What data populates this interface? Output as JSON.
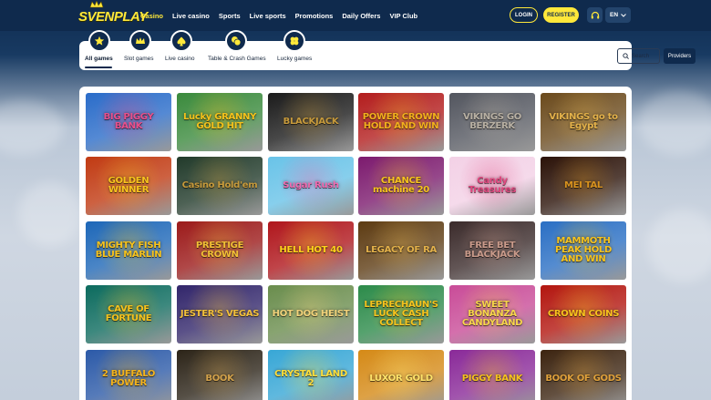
{
  "brand": {
    "logo_text": "SVENPLAY"
  },
  "nav": {
    "items": [
      {
        "label": "Casino",
        "active": true
      },
      {
        "label": "Live casino",
        "active": false
      },
      {
        "label": "Sports",
        "active": false
      },
      {
        "label": "Live sports",
        "active": false
      },
      {
        "label": "Promotions",
        "active": false
      },
      {
        "label": "Daily Offers",
        "active": false
      },
      {
        "label": "VIP Club",
        "active": false
      }
    ]
  },
  "header": {
    "login_label": "LOGIN",
    "register_label": "REGISTER",
    "headset_icon": "headset-icon",
    "language": "EN"
  },
  "categories": {
    "items": [
      {
        "label": "All games",
        "icon": "star-icon",
        "active": true
      },
      {
        "label": "Slot games",
        "icon": "crown-icon",
        "active": false
      },
      {
        "label": "Live casino",
        "icon": "spade-icon",
        "active": false
      },
      {
        "label": "Table & Crash Games",
        "icon": "chips-icon",
        "active": false
      },
      {
        "label": "Lucky games",
        "icon": "clover-icon",
        "active": false
      }
    ],
    "search_placeholder": "Search",
    "providers_label": "Providers"
  },
  "games": {
    "rows": [
      [
        {
          "title": "BIG PIGGY BANK",
          "bg": "#2a6cc9",
          "accent": "#e94f8b"
        },
        {
          "title": "Lucky GRANNY GOLD HIT",
          "bg": "#3a8a3c",
          "accent": "#f5c21b"
        },
        {
          "title": "BLACKJACK",
          "bg": "#1b1b1b",
          "accent": "#c79a3b"
        },
        {
          "title": "POWER CROWN HOLD AND WIN",
          "bg": "#b31d1d",
          "accent": "#f2b01c"
        },
        {
          "title": "VIKINGS GO BERZERK",
          "bg": "#53565f",
          "accent": "#b8b0a3"
        },
        {
          "title": "VIKINGS go to Egypt",
          "bg": "#6b4a1c",
          "accent": "#e3b14a"
        }
      ],
      [
        {
          "title": "GOLDEN WINNER",
          "bg": "#c13a12",
          "accent": "#f7c31d"
        },
        {
          "title": "Casino Hold'em",
          "bg": "#213a2a",
          "accent": "#c79a3b"
        },
        {
          "title": "Sugar Rush",
          "bg": "#69c3e8",
          "accent": "#f06bb0"
        },
        {
          "title": "CHANCE machine 20",
          "bg": "#7c1a6e",
          "accent": "#f7c31d"
        },
        {
          "title": "Candy Treasures",
          "bg": "#f3d1e6",
          "accent": "#e2477f"
        },
        {
          "title": "MEI TAL",
          "bg": "#2b1208",
          "accent": "#d8921e"
        }
      ],
      [
        {
          "title": "MIGHTY FISH BLUE MARLIN",
          "bg": "#1d67b8",
          "accent": "#f7c31d"
        },
        {
          "title": "PRESTIGE CROWN",
          "bg": "#9c1a1a",
          "accent": "#f2c035"
        },
        {
          "title": "HELL HOT 40",
          "bg": "#b0161c",
          "accent": "#ffd21a"
        },
        {
          "title": "LEGACY OF RA",
          "bg": "#5d3b12",
          "accent": "#e3b14a"
        },
        {
          "title": "FREE BET BLACKJACK",
          "bg": "#3b2b2b",
          "accent": "#c99a8a"
        },
        {
          "title": "MAMMOTH PEAK HOLD AND WIN",
          "bg": "#2a6fc4",
          "accent": "#f7c31d"
        }
      ],
      [
        {
          "title": "CAVE OF FORTUNE",
          "bg": "#0c6b5e",
          "accent": "#f7c31d"
        },
        {
          "title": "JESTER'S VEGAS",
          "bg": "#32266b",
          "accent": "#f3c03a"
        },
        {
          "title": "HOT DOG HEIST",
          "bg": "#6a8d4d",
          "accent": "#f2d27a"
        },
        {
          "title": "LEPRECHAUN'S LUCK CASH COLLECT",
          "bg": "#2c8b4a",
          "accent": "#f7c31d"
        },
        {
          "title": "SWEET BONANZA CANDYLAND",
          "bg": "#c94c98",
          "accent": "#f7d64a"
        },
        {
          "title": "CROWN COINS",
          "bg": "#b3160f",
          "accent": "#f7c31d"
        }
      ],
      [
        {
          "title": "2 BUFFALO POWER",
          "bg": "#2c5aa8",
          "accent": "#f4b31c"
        },
        {
          "title": "BOOK",
          "bg": "#2c2418",
          "accent": "#d3a24b"
        },
        {
          "title": "CRYSTAL LAND 2",
          "bg": "#38a7d6",
          "accent": "#ffde3a"
        },
        {
          "title": "LUXOR GOLD",
          "bg": "#d58a17",
          "accent": "#ffe36a"
        },
        {
          "title": "PIGGY BANK",
          "bg": "#8a2a99",
          "accent": "#f7c31d"
        },
        {
          "title": "BOOK OF GODS",
          "bg": "#3c2410",
          "accent": "#e0a13b"
        }
      ]
    ]
  }
}
